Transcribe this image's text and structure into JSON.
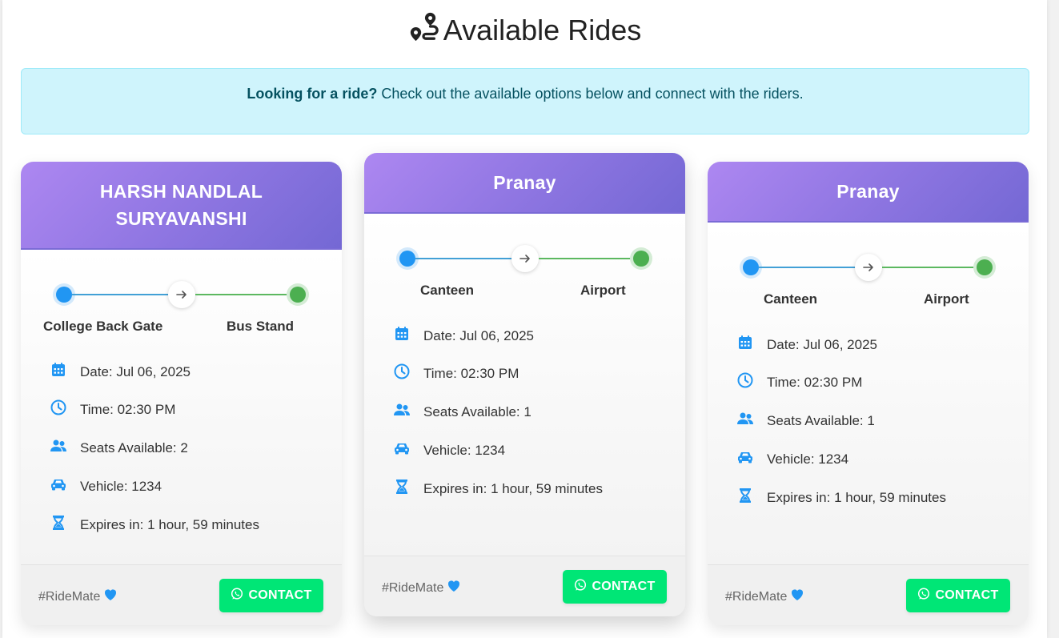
{
  "page": {
    "title": "Available Rides",
    "title_icon": "route-icon"
  },
  "alert": {
    "bold": "Looking for a ride?",
    "text": " Check out the available options below and connect with the riders."
  },
  "colors": {
    "accent_start": "#2196f3",
    "accent_end": "#4caf50",
    "header_gradient_from": "#ad87f1",
    "header_gradient_to": "#7468d4",
    "contact_button": "#00e676",
    "icon_blue": "#2196f3",
    "heart": "#2196f3"
  },
  "rides": [
    {
      "name_line1": "HARSH NANDLAL",
      "name_line2": "SURYAVANSHI",
      "from": "College Back Gate",
      "to": "Bus Stand",
      "date": "Date: Jul 06, 2025",
      "time": "Time: 02:30 PM",
      "seats": "Seats Available: 2",
      "vehicle": "Vehicle: 1234",
      "expires": "Expires in: 1 hour, 59 minutes",
      "tag": "#RideMate",
      "contact_label": "CONTACT"
    },
    {
      "name_line1": "Pranay",
      "from": "Canteen",
      "to": "Airport",
      "date": "Date: Jul 06, 2025",
      "time": "Time: 02:30 PM",
      "seats": "Seats Available: 1",
      "vehicle": "Vehicle: 1234",
      "expires": "Expires in: 1 hour, 59 minutes",
      "tag": "#RideMate",
      "contact_label": "CONTACT"
    },
    {
      "name_line1": "Pranay",
      "from": "Canteen",
      "to": "Airport",
      "date": "Date: Jul 06, 2025",
      "time": "Time: 02:30 PM",
      "seats": "Seats Available: 1",
      "vehicle": "Vehicle: 1234",
      "expires": "Expires in: 1 hour, 59 minutes",
      "tag": "#RideMate",
      "contact_label": "CONTACT"
    }
  ]
}
